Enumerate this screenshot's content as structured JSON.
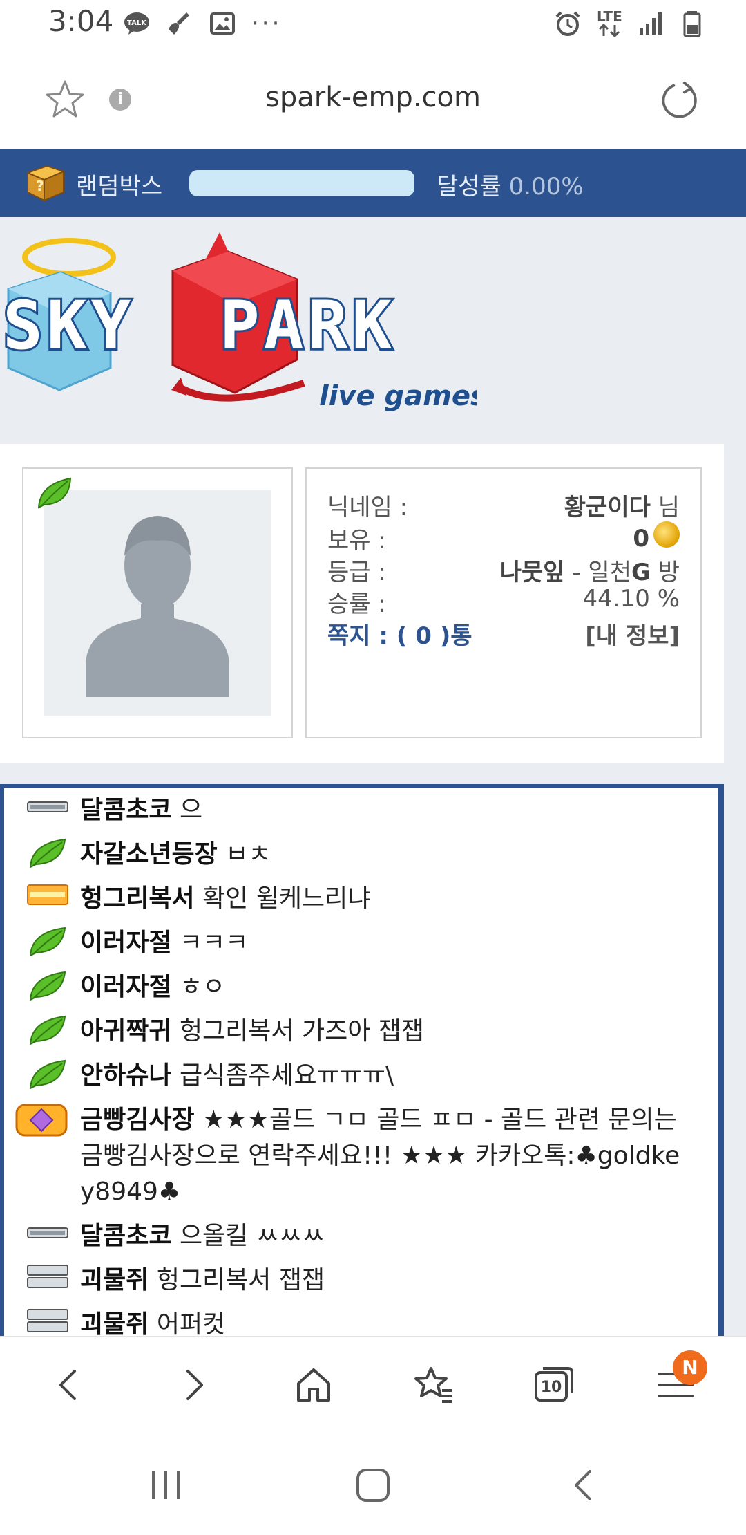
{
  "status_bar": {
    "time": "3:04",
    "left_icons": [
      "talk-icon",
      "broom-icon",
      "image-icon"
    ],
    "more": "···",
    "network": "LTE"
  },
  "browser": {
    "url": "spark-emp.com",
    "info_glyph": "i"
  },
  "random_box": {
    "label": "랜덤박스",
    "progress": 0,
    "rate_label": "달성률",
    "rate_value": "0.00%"
  },
  "logo": {
    "word1": "SKY",
    "word2": "PARK",
    "tagline": "live games"
  },
  "profile": {
    "nickname_label": "닉네임 :",
    "nickname": "황군이다",
    "nickname_suffix": "님",
    "balance_label": "보유 :",
    "balance": "0",
    "grade_label": "등급 :",
    "grade_name": "나뭇잎",
    "grade_sep": " - 일천",
    "grade_g": "G",
    "grade_suffix": " 방",
    "winrate_label": "승률 :",
    "winrate": "44.10 %",
    "messages": "쪽지 : ( 0 )통",
    "my_info": "[내 정보]"
  },
  "chat": [
    {
      "badge": "silver-bar",
      "nick": "달콤초코",
      "text": "으"
    },
    {
      "badge": "leaf",
      "nick": "자갈소년등장",
      "text": "ㅂㅊ"
    },
    {
      "badge": "gold-bar",
      "nick": "헝그리복서",
      "text": "확인 윌케느리냐"
    },
    {
      "badge": "leaf",
      "nick": "이러자절",
      "text": "ㅋㅋㅋ"
    },
    {
      "badge": "leaf",
      "nick": "이러자절",
      "text": "ㅎㅇ"
    },
    {
      "badge": "leaf",
      "nick": "아귀짝귀",
      "text": "헝그리복서 가즈아 잽잽"
    },
    {
      "badge": "leaf",
      "nick": "안하슈나",
      "text": "급식좀주세요ㅠㅠㅠ\\"
    },
    {
      "badge": "gem",
      "nick": "금빵김사장",
      "text": "★★★골드 ㄱㅁ 골드 ㅍㅁ - 골드 관련 문의는",
      "line2": "금빵김사장으로 연락주세요!!! ★★★ 카카오톡:♣goldke",
      "line3": "y8949♣"
    },
    {
      "badge": "silver-bar",
      "nick": "달콤초코",
      "text": "으올킬 ㅆㅆㅆ"
    },
    {
      "badge": "stack-bar",
      "nick": "괴물쥐",
      "text": "헝그리복서 잽잽"
    },
    {
      "badge": "stack-bar",
      "nick": "괴물쥐",
      "text": "어퍼컷"
    }
  ],
  "bottom_nav": {
    "tabs_count": "10",
    "menu_badge": "N"
  },
  "colors": {
    "brand_blue": "#2d5290",
    "progress_fill": "#cde9f7",
    "badge_orange": "#f06b1b"
  }
}
